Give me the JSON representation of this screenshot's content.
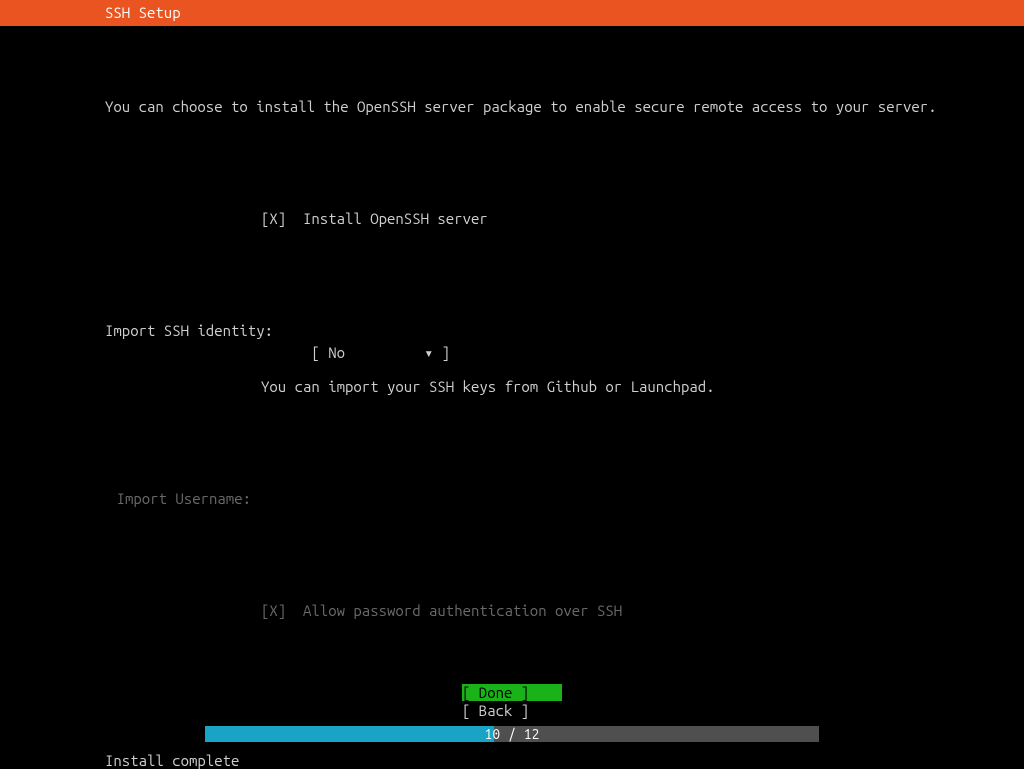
{
  "header": {
    "title": "SSH Setup"
  },
  "intro": "You can choose to install the OpenSSH server package to enable secure remote access to your server.",
  "install": {
    "checkbox": "[X]",
    "label": "Install OpenSSH server"
  },
  "import_identity": {
    "label": "Import SSH identity:",
    "open_bracket": "[ ",
    "value": "No",
    "arrow": "▾",
    "close_bracket": " ]",
    "hint": "You can import your SSH keys from Github or Launchpad."
  },
  "import_username": {
    "label": "Import Username:"
  },
  "allow_password": {
    "checkbox": "[X]",
    "label": "Allow password authentication over SSH"
  },
  "buttons": {
    "done": "[ Done       ]",
    "back": "[ Back       ]"
  },
  "progress": {
    "text": "10 / 12",
    "percent": 47
  },
  "status": "Install complete"
}
